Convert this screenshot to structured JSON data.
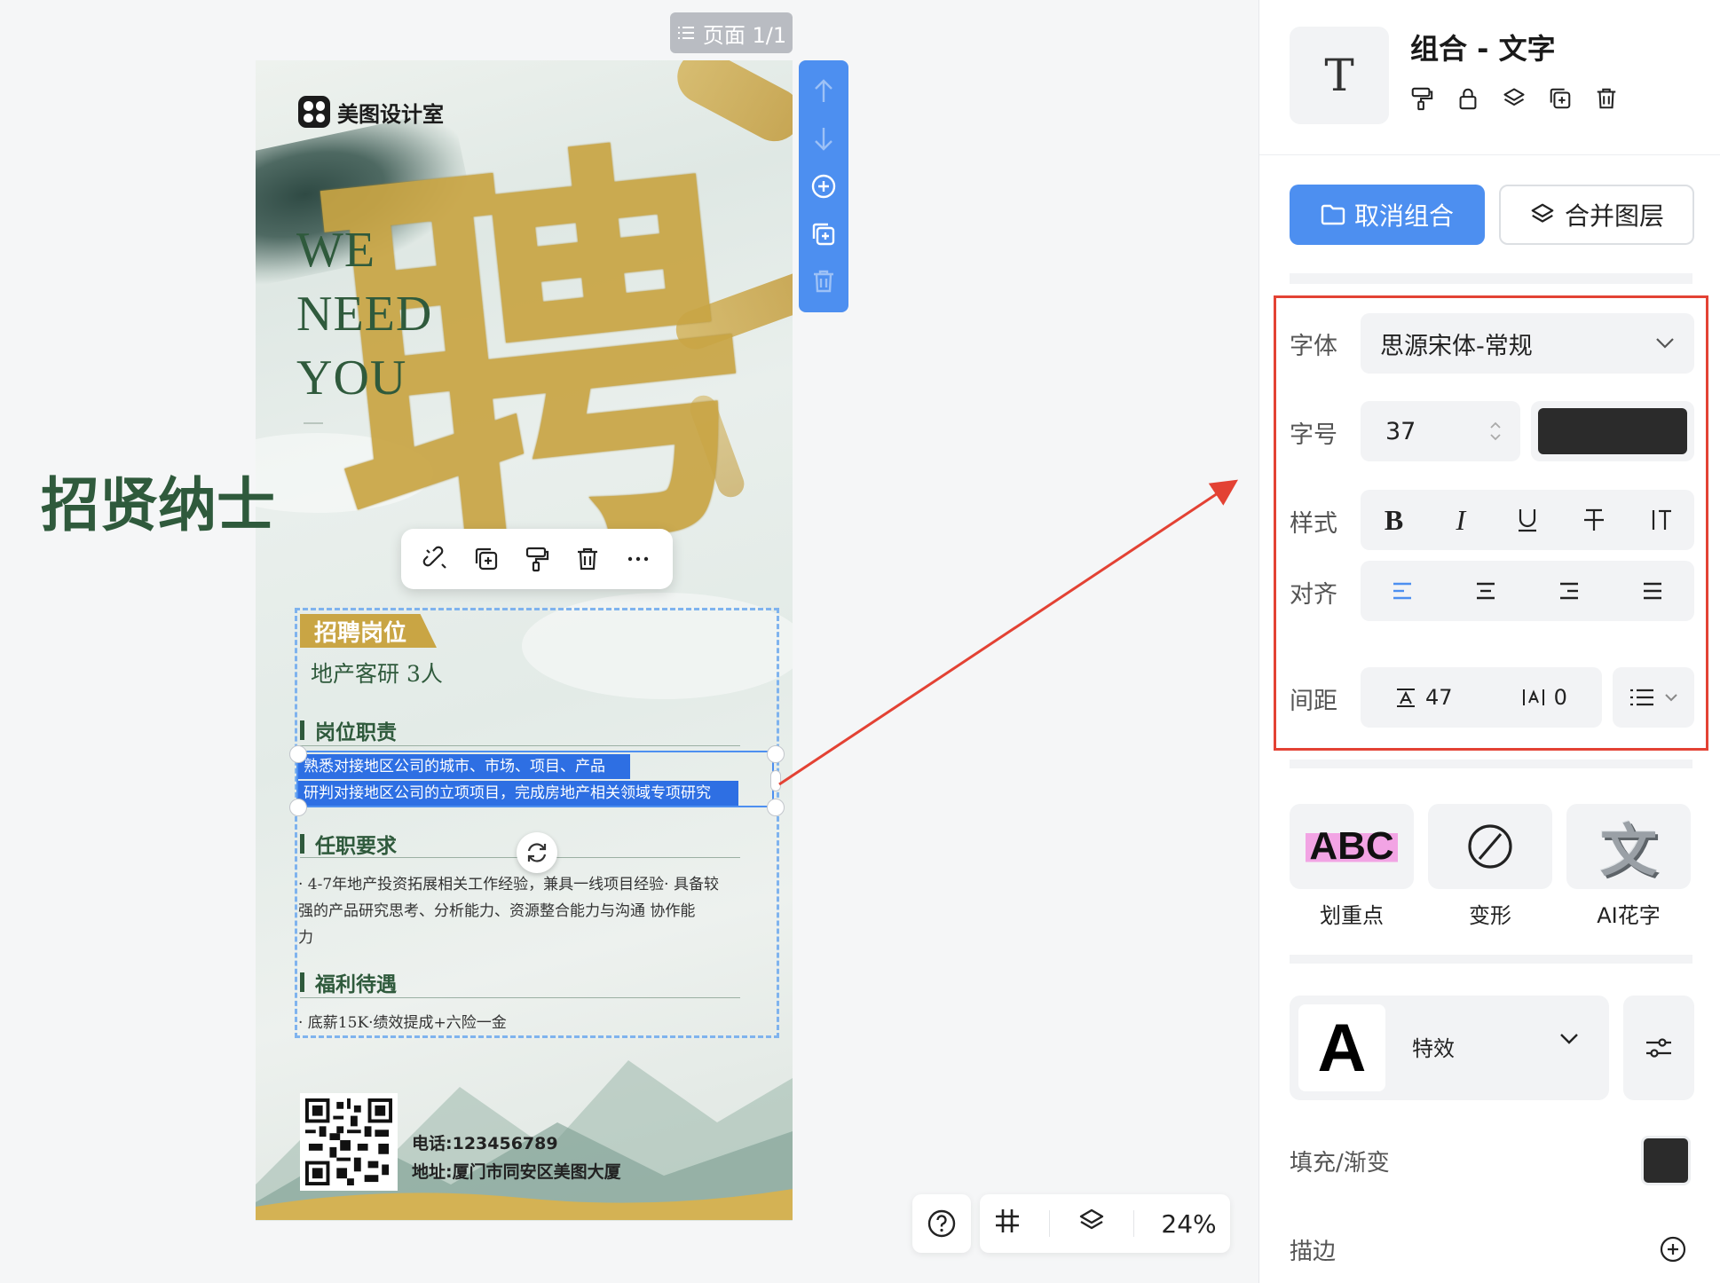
{
  "canvas": {
    "page_indicator": "页面 1/1",
    "zoom": "24%"
  },
  "poster": {
    "logo_text": "美图设计室",
    "we_lines": [
      "WE",
      "NEED",
      "YOU"
    ],
    "big_char": "聘",
    "headline": "招贤纳士",
    "tag": "招聘岗位",
    "job": "地产客研 3人",
    "sections": {
      "duty_title": "岗位职责",
      "duty_lines": [
        "熟悉对接地区公司的城市、市场、项目、产品",
        "研判对接地区公司的立项项目，完成房地产相关领域专项研究"
      ],
      "req_title": "任职要求",
      "req_lines": [
        "· 4-7年地产投资拓展相关工作经验，兼具一线项目经验· 具备较",
        "强的产品研究思考、分析能力、资源整合能力与沟通    协作能",
        "力"
      ],
      "benefit_title": "福利待遇",
      "benefit_line": "· 底薪15K·绩效提成+六险一金"
    },
    "phone": "电话:123456789",
    "address": "地址:厦门市同安区美图大厦"
  },
  "panel": {
    "title": "组合 - 文字",
    "icon_glyph": "T",
    "ungroup_label": "取消组合",
    "merge_label": "合并图层",
    "font_label": "字体",
    "font_value": "思源宋体-常规",
    "size_label": "字号",
    "size_value": "37",
    "text_color": "#2b2b2b",
    "style_label": "样式",
    "align_label": "对齐",
    "spacing_label": "间距",
    "letter_spacing": "47",
    "line_spacing": "0",
    "fx_items": [
      {
        "icon_text": "ABC",
        "label": "划重点"
      },
      {
        "label": "变形"
      },
      {
        "icon_text": "文",
        "label": "AI花字"
      }
    ],
    "effect_icon": "A",
    "effect_label": "特效",
    "fill_label": "填充/渐变",
    "fill_color": "#2b2b2b",
    "stroke_label": "描边",
    "accent_color": "#4d8ff0",
    "highlight_box_color": "#e34234"
  }
}
